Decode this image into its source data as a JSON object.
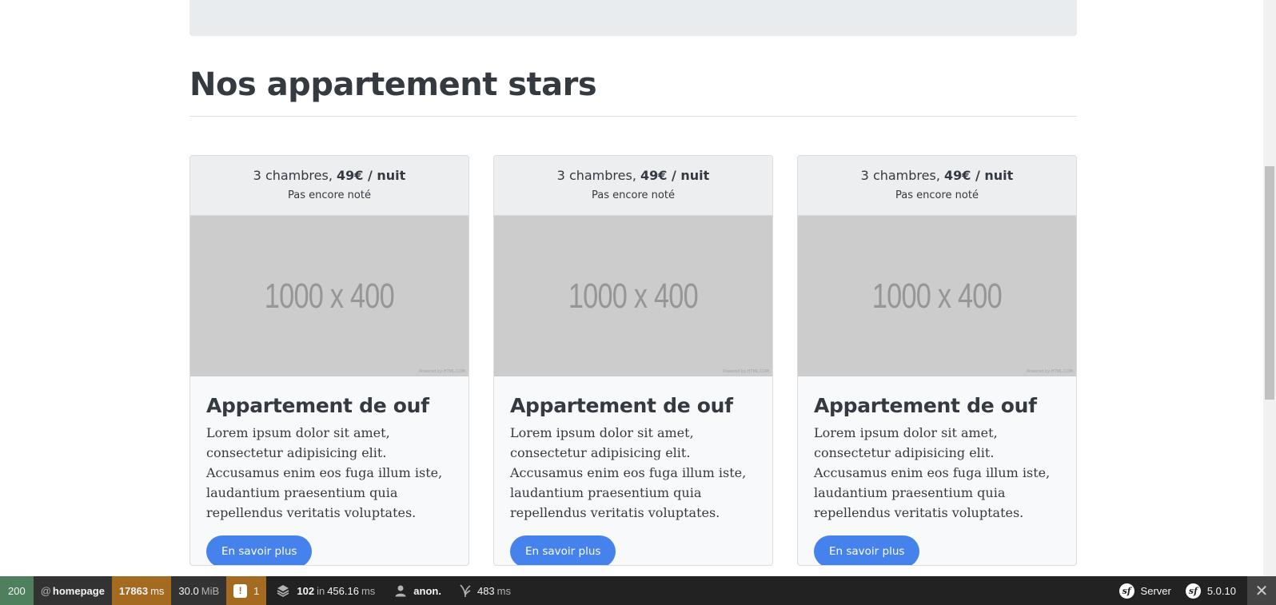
{
  "section": {
    "title": "Nos appartement stars"
  },
  "cards": [
    {
      "rooms": "3 chambres,",
      "price": "49€ / nuit",
      "rating": "Pas encore noté",
      "image_text": "1000 x 400",
      "image_credit": "Powered by HTML.COM",
      "title": "Appartement de ouf",
      "text": "Lorem ipsum dolor sit amet, consectetur adipisicing elit. Accusamus enim eos fuga illum iste, laudantium praesentium quia repellendus veritatis voluptates.",
      "button": "En savoir plus"
    },
    {
      "rooms": "3 chambres,",
      "price": "49€ / nuit",
      "rating": "Pas encore noté",
      "image_text": "1000 x 400",
      "image_credit": "Powered by HTML.COM",
      "title": "Appartement de ouf",
      "text": "Lorem ipsum dolor sit amet, consectetur adipisicing elit. Accusamus enim eos fuga illum iste, laudantium praesentium quia repellendus veritatis voluptates.",
      "button": "En savoir plus"
    },
    {
      "rooms": "3 chambres,",
      "price": "49€ / nuit",
      "rating": "Pas encore noté",
      "image_text": "1000 x 400",
      "image_credit": "Powered by HTML.COM",
      "title": "Appartement de ouf",
      "text": "Lorem ipsum dolor sit amet, consectetur adipisicing elit. Accusamus enim eos fuga illum iste, laudantium praesentium quia repellendus veritatis voluptates.",
      "button": "En savoir plus"
    }
  ],
  "toolbar": {
    "status_code": "200",
    "route_prefix": "@",
    "route": "homepage",
    "time_value": "17863",
    "time_unit": "ms",
    "memory_value": "30.0",
    "memory_unit": "MiB",
    "warnings_icon": "exclamation-icon",
    "warnings_count": "1",
    "db_icon": "layers-icon",
    "db_queries": "102",
    "db_in": "in",
    "db_time": "456.16",
    "db_time_unit": "ms",
    "user_icon": "person-icon",
    "user": "anon.",
    "twig_icon": "twig-icon",
    "twig_time": "483",
    "twig_unit": "ms",
    "server_label": "Server",
    "version": "5.0.10",
    "colors": {
      "status_ok": "#4f805d",
      "warning": "#a46a1f",
      "bar": "#222222"
    }
  },
  "colors": {
    "button": "#4582ec",
    "card_bg": "#f8f9fa",
    "image_placeholder": "#cccccc"
  }
}
